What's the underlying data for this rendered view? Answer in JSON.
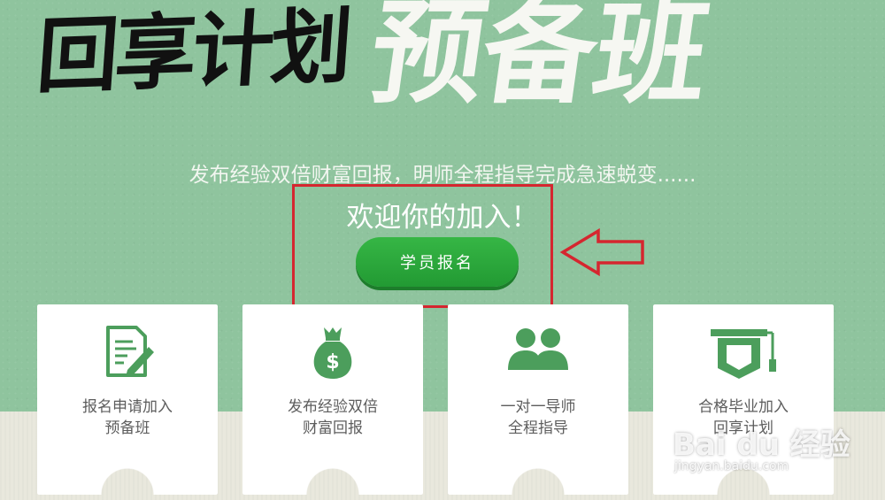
{
  "hero": {
    "title_black": "回享计划",
    "title_white": "预备班",
    "subtitle": "发布经验双倍财富回报，明师全程指导完成急速蜕变......",
    "welcome": "欢迎你的加入！",
    "enroll_label": "学员报名"
  },
  "colors": {
    "hero_bg": "#8fc49e",
    "accent_green": "#2aa63a",
    "highlight_red": "#d5262f",
    "icon_green": "#4c9e5c"
  },
  "cards": [
    {
      "icon": "application-form-icon",
      "line1": "报名申请加入",
      "line2": "预备班"
    },
    {
      "icon": "money-bag-icon",
      "line1": "发布经验双倍",
      "line2": "财富回报"
    },
    {
      "icon": "mentor-pair-icon",
      "line1": "一对一导师",
      "line2": "全程指导"
    },
    {
      "icon": "graduation-cap-icon",
      "line1": "合格毕业加入",
      "line2": "回享计划"
    }
  ],
  "watermark": {
    "brand": "Bai du 经验",
    "url": "jingyan.baidu.com"
  }
}
